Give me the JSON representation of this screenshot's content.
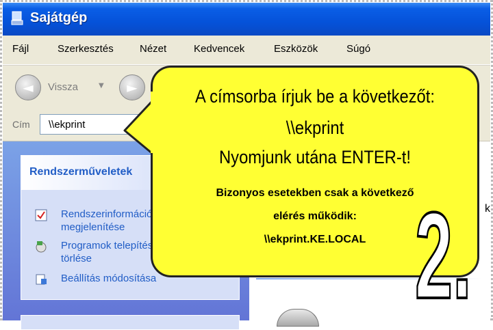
{
  "window": {
    "title": "Sajátgép"
  },
  "menu": [
    "Fájl",
    "Szerkesztés",
    "Nézet",
    "Kedvencek",
    "Eszközök",
    "Súgó"
  ],
  "toolbar": {
    "back_label": "Vissza"
  },
  "address": {
    "label": "Cím",
    "value": "\\\\ekprint"
  },
  "tasks": {
    "title": "Rendszerműveletek",
    "items": [
      {
        "label_line1": "Rendszerinformációk",
        "label_line2": "megjelenítése",
        "icon": "system-info-icon"
      },
      {
        "label_line1": "Programok telepítése",
        "label_line2": "törlése",
        "icon": "add-remove-programs-icon"
      },
      {
        "label_line1": "Beállítás módosítása",
        "label_line2": "",
        "icon": "change-setting-icon"
      }
    ]
  },
  "callout": {
    "line1": "A címsorba írjuk be a következőt:",
    "line2": "\\\\ekprint",
    "line3": "Nyomjunk utána ENTER-t!",
    "note_line1": "Bizonyos esetekben csak a következő",
    "note_line2": "elérés működik:",
    "note_line3": "\\\\ekprint.KE.LOCAL"
  },
  "step_number": "2.",
  "colors": {
    "callout_bg": "#ffff33",
    "titlebar": "#0552d9",
    "task_link": "#215dc6"
  }
}
